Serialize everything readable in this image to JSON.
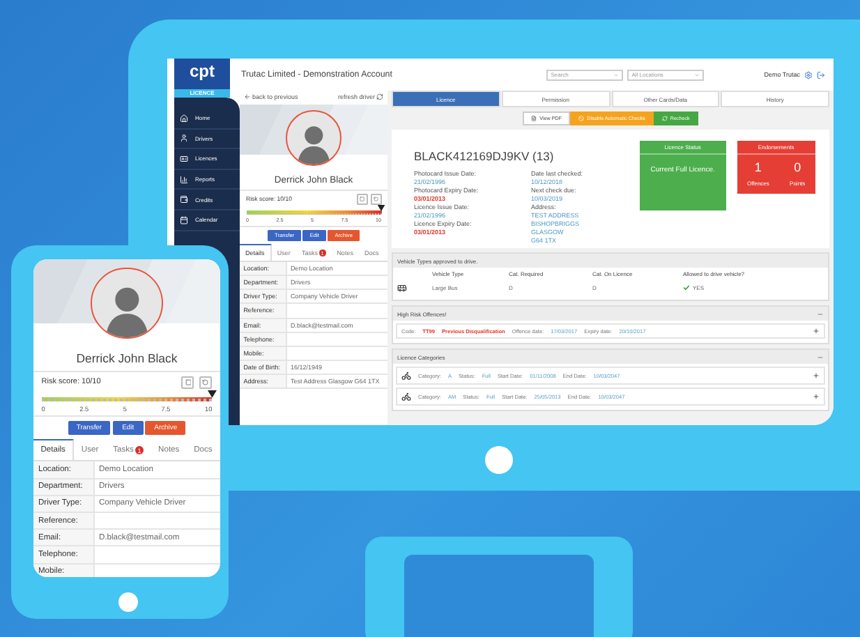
{
  "monitor": {
    "logo": {
      "name": "cpt",
      "sub": "LICENCE"
    },
    "title": "Trutac Limited - Demonstration Account",
    "search": {
      "placeholder": "Search"
    },
    "location": {
      "value": "All Locations"
    },
    "user": "Demo Trutac",
    "nav": [
      {
        "label": "Home"
      },
      {
        "label": "Drivers"
      },
      {
        "label": "Licences"
      },
      {
        "label": "Reports"
      },
      {
        "label": "Credits"
      },
      {
        "label": "Calendar"
      }
    ],
    "driver_panel": {
      "back": "back to previous",
      "refresh": "refresh driver",
      "name": "Derrick John Black",
      "risk": {
        "label": "Risk score: 10/10",
        "level": 1,
        "ticks": [
          "0",
          "2.5",
          "5",
          "7.5",
          "10"
        ]
      },
      "buttons": [
        {
          "label": "Transfer",
          "kind": "primary"
        },
        {
          "label": "Edit",
          "kind": "primary"
        },
        {
          "label": "Archive",
          "kind": "danger"
        }
      ],
      "tabs": [
        {
          "label": "Details",
          "selected": true
        },
        {
          "label": "User",
          "selected": false
        },
        {
          "label": "Tasks",
          "badge": "1",
          "selected": false
        },
        {
          "label": "Notes",
          "selected": false
        },
        {
          "label": "Docs",
          "selected": false
        }
      ],
      "rows": [
        {
          "label": "Location:",
          "value": "Demo Location"
        },
        {
          "label": "Department:",
          "value": "Drivers"
        },
        {
          "label": "Driver Type:",
          "value": "Company Vehicle Driver"
        },
        {
          "label": "Reference:"
        },
        {
          "label": "Email:",
          "value": "D.black@testmail.com"
        },
        {
          "label": "Telephone:"
        },
        {
          "label": "Mobile:"
        },
        {
          "label": "Date of Birth:",
          "value": "16/12/1949"
        },
        {
          "label": "Address:",
          "value": "Test Address Glasgow G64 1TX"
        }
      ]
    },
    "tabs": [
      {
        "label": "Licence",
        "selected": true
      },
      {
        "label": "Permission",
        "selected": false
      },
      {
        "label": "Other Cards/Data",
        "selected": false
      },
      {
        "label": "History",
        "selected": false
      }
    ],
    "actions": [
      {
        "label": "View PDF",
        "kind": "plain"
      },
      {
        "label": "Disable Automatic Checks",
        "kind": "warning"
      },
      {
        "label": "Recheck",
        "kind": "success"
      }
    ],
    "licence": {
      "number": "BLACK412169DJ9KV (13)",
      "fields_left": [
        {
          "label": "Photocard Issue Date:",
          "value": "21/02/1996",
          "expired": false
        },
        {
          "label": "Photocard Expiry Date:",
          "value": "03/01/2013",
          "expired": true
        },
        {
          "label": "Licence Issue Date:",
          "value": "21/02/1996",
          "expired": false
        },
        {
          "label": "Licence Expiry Date:",
          "value": "03/01/2013",
          "expired": true
        }
      ],
      "fields_right": [
        {
          "label": "Date last checked:",
          "lines": [
            "10/12/2018"
          ]
        },
        {
          "label": "Next check due:",
          "lines": [
            "10/03/2019"
          ]
        },
        {
          "label": "Address:",
          "lines": [
            "TEST ADDRESS",
            "BISHOPBRIGGS",
            "GLASGOW",
            "G64 1TX"
          ]
        }
      ]
    },
    "status_card": {
      "title": "Licence Status",
      "value": "Current Full Licence."
    },
    "endorsements": {
      "title": "Endorsements",
      "stats": [
        {
          "value": "1",
          "label": "Offences"
        },
        {
          "value": "0",
          "label": "Points"
        }
      ]
    },
    "vehicles": {
      "title": "Vehicle Types approved to drive.",
      "columns": [
        "Vehicle Type",
        "Cat. Required",
        "Cat. On Licence",
        "Allowed to drive vehicle?"
      ],
      "rows": [
        {
          "type": "Large Bus",
          "required": "D",
          "on_licence": "D",
          "allowed": "YES"
        }
      ]
    },
    "offences": {
      "title": "High Risk Offences!",
      "expanded": true,
      "rows": [
        {
          "code_label": "Code:",
          "code": "TT99",
          "description": "Previous Disqualification",
          "dates": [
            {
              "label": "Offence date:",
              "value": "17/03/2017"
            },
            {
              "label": "Expiry date:",
              "value": "20/10/2017"
            }
          ],
          "expanded": false
        }
      ]
    },
    "categories": {
      "title": "Licence Categories",
      "expanded": true,
      "rows": [
        {
          "fields": [
            {
              "label": "Category:",
              "value": "A"
            },
            {
              "label": "Status:",
              "value": "Full"
            },
            {
              "label": "Start Date:",
              "value": "01/11/2008"
            },
            {
              "label": "End Date:",
              "value": "10/03/2047"
            }
          ],
          "expanded": false
        },
        {
          "fields": [
            {
              "label": "Category:",
              "value": "AM"
            },
            {
              "label": "Status:",
              "value": "Full"
            },
            {
              "label": "Start Date:",
              "value": "25/05/2013"
            },
            {
              "label": "End Date:",
              "value": "10/03/2047"
            }
          ],
          "expanded": false
        }
      ]
    }
  },
  "phone": {
    "driver_panel": {
      "name": "Derrick John Black",
      "risk": {
        "label": "Risk score: 10/10",
        "level": 1,
        "ticks": [
          "0",
          "2.5",
          "5",
          "7.5",
          "10"
        ]
      },
      "buttons": [
        {
          "label": "Transfer",
          "kind": "primary"
        },
        {
          "label": "Edit",
          "kind": "primary"
        },
        {
          "label": "Archive",
          "kind": "danger"
        }
      ],
      "tabs": [
        {
          "label": "Details",
          "selected": true
        },
        {
          "label": "User",
          "selected": false
        },
        {
          "label": "Tasks",
          "badge": "1",
          "selected": false
        },
        {
          "label": "Notes",
          "selected": false
        },
        {
          "label": "Docs",
          "selected": false
        }
      ],
      "rows": [
        {
          "label": "Location:",
          "value": "Demo Location"
        },
        {
          "label": "Department:",
          "value": "Drivers"
        },
        {
          "label": "Driver Type:",
          "value": "Company Vehicle Driver"
        },
        {
          "label": "Reference:"
        },
        {
          "label": "Email:",
          "value": "D.black@testmail.com"
        },
        {
          "label": "Telephone:"
        },
        {
          "label": "Mobile:"
        }
      ]
    }
  }
}
